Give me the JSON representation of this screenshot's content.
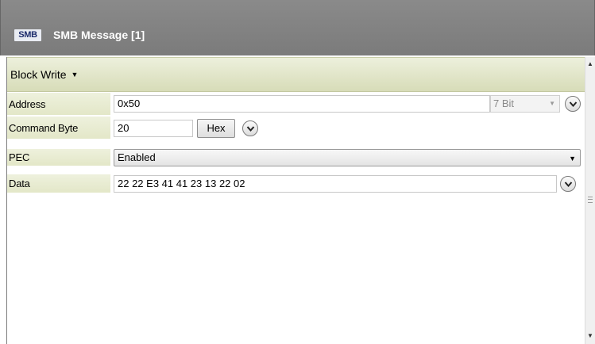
{
  "window": {
    "logo_text": "SMB",
    "title": "SMB Message [1]"
  },
  "mode": {
    "label": "Block Write",
    "caret": "▼"
  },
  "rows": {
    "address": {
      "label": "Address",
      "value": "0x50",
      "bits_selected": "7 Bit",
      "caret": "▼"
    },
    "command": {
      "label": "Command Byte",
      "value": "20",
      "format_button": "Hex"
    },
    "pec": {
      "label": "PEC",
      "value": "Enabled",
      "caret": "▼"
    },
    "data": {
      "label": "Data",
      "value": "22 22 E3 41 41 23 13 22 02"
    }
  },
  "scrollbar": {
    "up": "▲",
    "down": "▼"
  },
  "colors": {
    "titlebar": "#808080",
    "label_bg": "#e8ebd2",
    "logo_text": "#1b2a6b"
  }
}
